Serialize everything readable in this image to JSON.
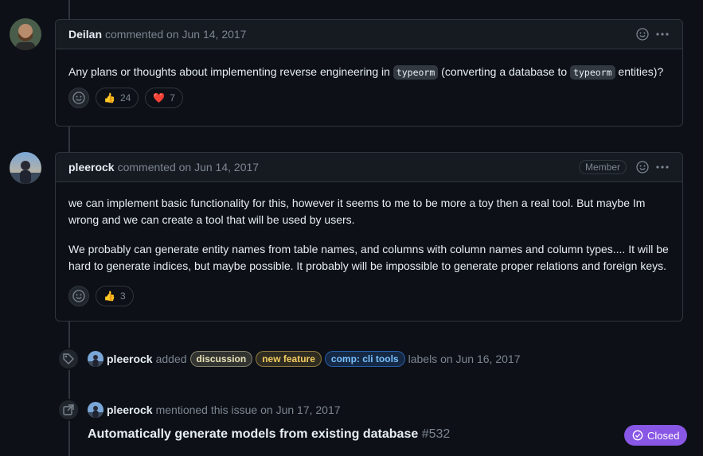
{
  "comment1": {
    "author": "Deilan",
    "meta": "commented on Jun 14, 2017",
    "text_a": "Any plans or thoughts about implementing reverse engineering in",
    "code_a": "typeorm",
    "text_b": "(converting a database to",
    "code_b": "typeorm",
    "text_c": "entities)?",
    "reactions": [
      {
        "emoji": "👍",
        "count": "24"
      },
      {
        "emoji": "❤️",
        "count": "7"
      }
    ]
  },
  "comment2": {
    "author": "pleerock",
    "meta": "commented on Jun 14, 2017",
    "badge": "Member",
    "para1": "we can implement basic functionality for this, however it seems to me to be more a toy then a real tool. But maybe Im wrong and we can create a tool that will be used by users.",
    "para2": "We probably can generate entity names from table names, and columns with column names and column types.... It will be hard to generate indices, but maybe possible. It probably will be impossible to generate proper relations and foreign keys.",
    "reactions": [
      {
        "emoji": "👍",
        "count": "3"
      }
    ]
  },
  "label_event": {
    "author": "pleerock",
    "action": "added",
    "labels": [
      {
        "name": "discussion",
        "color": "#d9d2a9"
      },
      {
        "name": "new feature",
        "color": "#f2cc60"
      },
      {
        "name": "comp: cli tools",
        "color": "#58a6ff"
      }
    ],
    "suffix": "labels on Jun 16, 2017"
  },
  "mention_event": {
    "author": "pleerock",
    "text": "mentioned this issue on Jun 17, 2017",
    "ref_title": "Automatically generate models from existing database",
    "ref_number": "#532",
    "status": "Closed"
  }
}
